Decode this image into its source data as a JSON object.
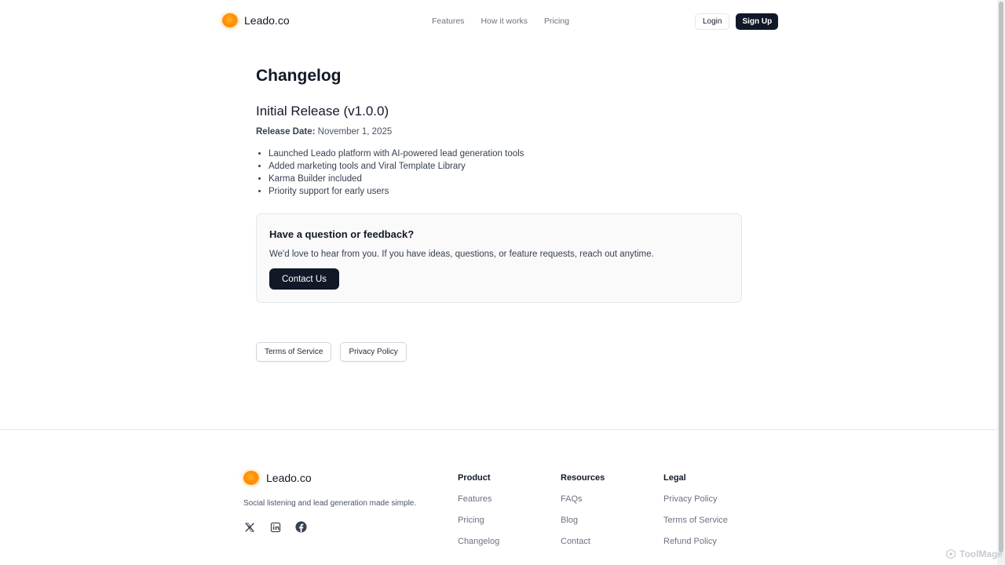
{
  "header": {
    "brand": "Leado.co",
    "nav": [
      "Features",
      "How it works",
      "Pricing"
    ],
    "login": "Login",
    "signup": "Sign Up"
  },
  "main": {
    "title": "Changelog",
    "release": {
      "title": "Initial Release (v1.0.0)",
      "date_label": "Release Date:",
      "date_value": "November 1, 2025",
      "items": [
        "Launched Leado platform with AI-powered lead generation tools",
        "Added marketing tools and Viral Template Library",
        "Karma Builder included",
        "Priority support for early users"
      ]
    },
    "feedback": {
      "title": "Have a question or feedback?",
      "text": "We'd love to hear from you. If you have ideas, questions, or feature requests, reach out anytime.",
      "button": "Contact Us"
    },
    "legal_links": [
      "Terms of Service",
      "Privacy Policy"
    ]
  },
  "footer": {
    "brand": "Leado.co",
    "tagline": "Social listening and lead generation made simple.",
    "socials": [
      "x-icon",
      "linkedin-icon",
      "facebook-icon"
    ],
    "columns": [
      {
        "title": "Product",
        "links": [
          "Features",
          "Pricing",
          "Changelog"
        ]
      },
      {
        "title": "Resources",
        "links": [
          "FAQs",
          "Blog",
          "Contact"
        ]
      },
      {
        "title": "Legal",
        "links": [
          "Privacy Policy",
          "Terms of Service",
          "Refund Policy"
        ]
      }
    ]
  },
  "watermark": "ToolMage",
  "colors": {
    "accent": "#ff8a00",
    "dark": "#111827",
    "muted": "#6b7280"
  }
}
